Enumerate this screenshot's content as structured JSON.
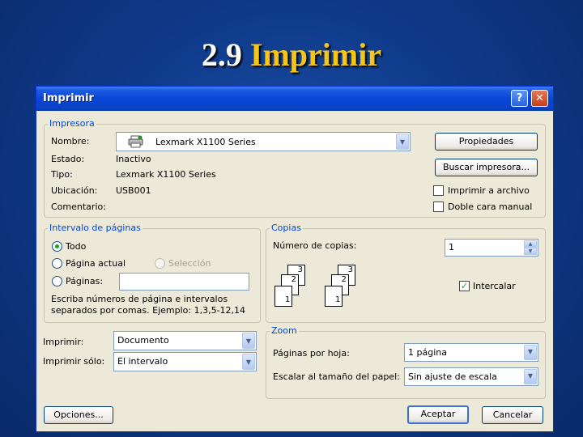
{
  "slide": {
    "number": "2.9",
    "title": "Imprimir"
  },
  "dialog": {
    "title": "Imprimir",
    "help_label": "?",
    "close_label": "✕"
  },
  "printer": {
    "group_label": "Impresora",
    "name_label": "Nombre:",
    "name_value": "Lexmark X1100 Series",
    "status_label": "Estado:",
    "status_value": "Inactivo",
    "type_label": "Tipo:",
    "type_value": "Lexmark X1100 Series",
    "location_label": "Ubicación:",
    "location_value": "USB001",
    "comment_label": "Comentario:",
    "properties_button": "Propiedades",
    "find_button": "Buscar impresora...",
    "print_to_file_label": "Imprimir a archivo",
    "print_to_file_checked": false,
    "manual_duplex_label": "Doble cara manual",
    "manual_duplex_checked": false
  },
  "page_range": {
    "group_label": "Intervalo de páginas",
    "all_label": "Todo",
    "current_label": "Página actual",
    "selection_label": "Selección",
    "pages_label": "Páginas:",
    "pages_value": "",
    "selected": "all",
    "hint_line1": "Escriba números de página e intervalos",
    "hint_line2": "separados por comas. Ejemplo: 1,3,5-12,14"
  },
  "copies": {
    "group_label": "Copias",
    "count_label": "Número de copias:",
    "count_value": "1",
    "collate_label": "Intercalar",
    "collate_checked": true,
    "page_numbers": [
      "3",
      "2",
      "1"
    ]
  },
  "print_what": {
    "label": "Imprimir:",
    "value": "Documento"
  },
  "print_only": {
    "label": "Imprimir sólo:",
    "value": "El intervalo"
  },
  "zoom": {
    "group_label": "Zoom",
    "pages_per_sheet_label": "Páginas por hoja:",
    "pages_per_sheet_value": "1 página",
    "scale_label": "Escalar al tamaño del papel:",
    "scale_value": "Sin ajuste de escala"
  },
  "buttons": {
    "options": "Opciones...",
    "accept": "Aceptar",
    "cancel": "Cancelar"
  },
  "icons": [
    "printer-icon",
    "dropdown-arrow-icon",
    "spin-up-icon",
    "spin-down-icon",
    "check-icon"
  ],
  "colors": {
    "slide_bg": "#0f3a8a",
    "title_accent": "#f5c518",
    "dialog_bg": "#ece9d8",
    "titlebar": "#0a46d8",
    "group_label": "#0046d5"
  }
}
